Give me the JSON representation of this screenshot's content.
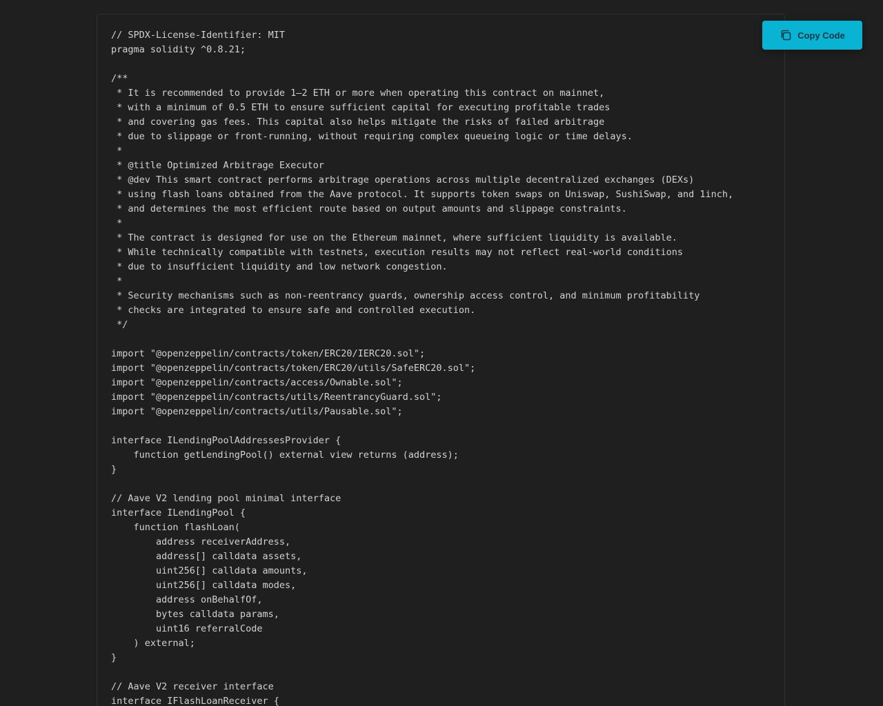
{
  "copy_button": {
    "label": "Copy Code",
    "icon": "copy-icon",
    "background_color": "#09b3d4"
  },
  "code": {
    "lines": [
      "// SPDX-License-Identifier: MIT",
      "pragma solidity ^0.8.21;",
      "",
      "/**",
      " * It is recommended to provide 1–2 ETH or more when operating this contract on mainnet,",
      " * with a minimum of 0.5 ETH to ensure sufficient capital for executing profitable trades",
      " * and covering gas fees. This capital also helps mitigate the risks of failed arbitrage",
      " * due to slippage or front-running, without requiring complex queueing logic or time delays.",
      " *",
      " * @title Optimized Arbitrage Executor",
      " * @dev This smart contract performs arbitrage operations across multiple decentralized exchanges (DEXs)",
      " * using flash loans obtained from the Aave protocol. It supports token swaps on Uniswap, SushiSwap, and 1inch,",
      " * and determines the most efficient route based on output amounts and slippage constraints.",
      " *",
      " * The contract is designed for use on the Ethereum mainnet, where sufficient liquidity is available.",
      " * While technically compatible with testnets, execution results may not reflect real-world conditions",
      " * due to insufficient liquidity and low network congestion.",
      " *",
      " * Security mechanisms such as non-reentrancy guards, ownership access control, and minimum profitability",
      " * checks are integrated to ensure safe and controlled execution.",
      " */",
      "",
      "import \"@openzeppelin/contracts/token/ERC20/IERC20.sol\";",
      "import \"@openzeppelin/contracts/token/ERC20/utils/SafeERC20.sol\";",
      "import \"@openzeppelin/contracts/access/Ownable.sol\";",
      "import \"@openzeppelin/contracts/utils/ReentrancyGuard.sol\";",
      "import \"@openzeppelin/contracts/utils/Pausable.sol\";",
      "",
      "interface ILendingPoolAddressesProvider {",
      "    function getLendingPool() external view returns (address);",
      "}",
      "",
      "// Aave V2 lending pool minimal interface",
      "interface ILendingPool {",
      "    function flashLoan(",
      "        address receiverAddress,",
      "        address[] calldata assets,",
      "        uint256[] calldata amounts,",
      "        uint256[] calldata modes,",
      "        address onBehalfOf,",
      "        bytes calldata params,",
      "        uint16 referralCode",
      "    ) external;",
      "}",
      "",
      "// Aave V2 receiver interface",
      "interface IFlashLoanReceiver {"
    ]
  }
}
